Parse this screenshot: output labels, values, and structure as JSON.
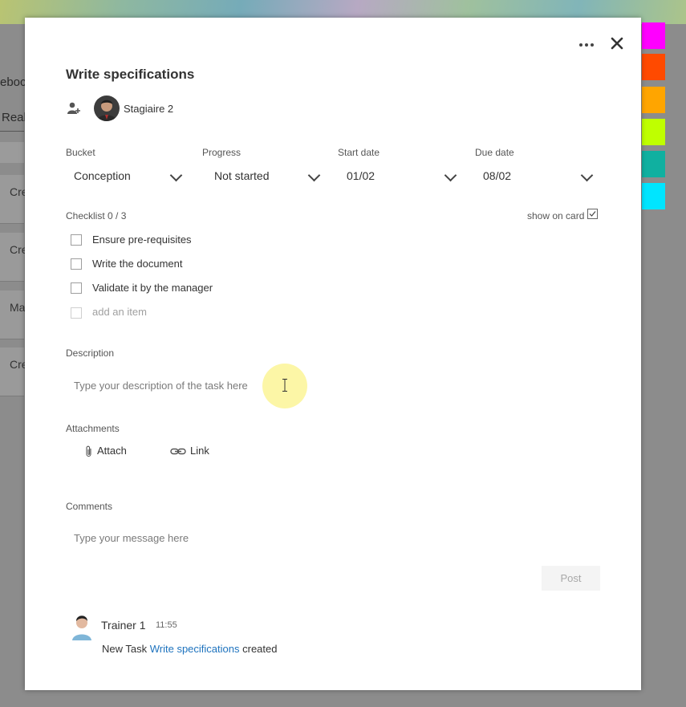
{
  "background": {
    "fragments": [
      "eboc",
      "Reali",
      "Cre",
      "Cre",
      "Ma",
      "Cre"
    ],
    "swatch_colors": [
      "#ff00ff",
      "#ff4a00",
      "#ffa500",
      "#bfff00",
      "#10b0a0",
      "#00e5ff"
    ]
  },
  "task": {
    "title": "Write specifications",
    "more_icon": "more-icon",
    "close_icon": "close-icon",
    "assign_icon": "add-person-icon",
    "assignee": "Stagiaire 2"
  },
  "fields": {
    "bucket": {
      "label": "Bucket",
      "value": "Conception"
    },
    "progress": {
      "label": "Progress",
      "value": "Not started"
    },
    "start": {
      "label": "Start date",
      "value": "01/02"
    },
    "due": {
      "label": "Due date",
      "value": "08/02"
    }
  },
  "checklist": {
    "header": "Checklist 0 / 3",
    "show_on_card": "show on card",
    "items": [
      "Ensure pre-requisites",
      "Write the document",
      "Validate it by the manager"
    ],
    "add_placeholder": "add an item"
  },
  "description": {
    "label": "Description",
    "placeholder": "Type your description of the task here"
  },
  "attachments": {
    "label": "Attachments",
    "attach": "Attach",
    "link": "Link"
  },
  "comments": {
    "label": "Comments",
    "placeholder": "Type your message here",
    "post": "Post",
    "entry": {
      "author": "Trainer 1",
      "time": "11:55",
      "text_before": "New Task",
      "task_link": "Write specifications",
      "text_after": "created"
    }
  }
}
